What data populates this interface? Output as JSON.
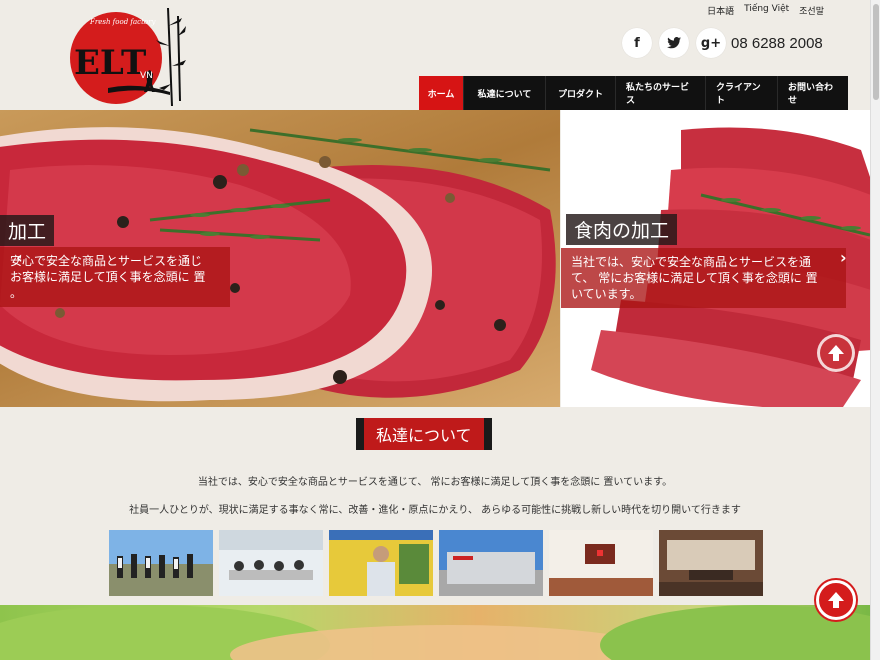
{
  "header": {
    "logo_text": "ELT",
    "logo_sub": "VN",
    "logo_tagline": "Fresh food factory",
    "languages": [
      "日本語",
      "Tiếng Việt",
      "조선말"
    ],
    "social": [
      "f",
      "t",
      "g+"
    ],
    "phone": "08 6288 2008"
  },
  "nav": {
    "items": [
      "ホーム",
      "私達について",
      "プロダクト",
      "私たちのサービス",
      "クライアント",
      "お問い合わせ"
    ],
    "active": 0
  },
  "hero": {
    "slide_a": {
      "title": "加工",
      "text_lines": [
        "安心で安全な商品とサービスを通じ",
        "お客様に満足して頂く事を念頭に 置",
        "。"
      ]
    },
    "slide_b": {
      "title": "食肉の加工",
      "text_lines": [
        "当社では、安心で安全な商品とサービスを通",
        "て、 常にお客様に満足して頂く事を念頭に 置",
        "いています。"
      ]
    },
    "prev_arrow": "‹",
    "next_arrow": "›"
  },
  "about": {
    "title": "私達について",
    "p1": "当社では、安心で安全な商品とサービスを通じて、 常にお客様に満足して頂く事を念頭に 置いています。",
    "p2": "社員一人ひとりが、現状に満足する事なく常に、改善・進化・原点にかえり、 あらゆる可能性に挑戦し新しい時代を切り開いて行きます"
  },
  "colors": {
    "brand_red": "#d61414",
    "nav_bg": "#111111",
    "page_bg": "#efece6"
  }
}
